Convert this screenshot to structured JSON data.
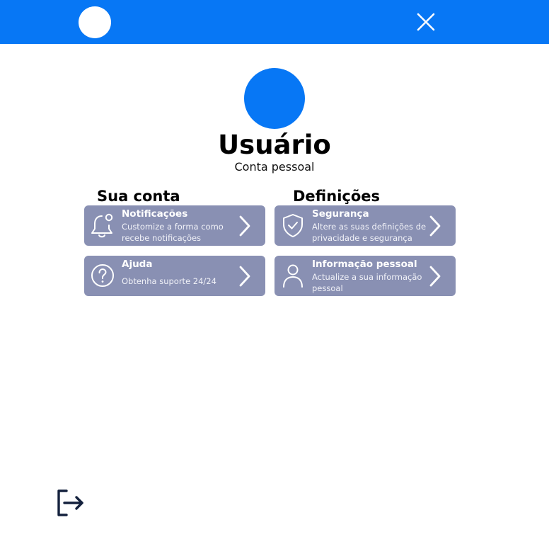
{
  "header": {
    "background_color": "#0777f5",
    "avatar_icon": "user-avatar",
    "close_icon": "close-icon"
  },
  "profile": {
    "name": "Usuário",
    "subtitle": "Conta pessoal",
    "avatar_color": "#0777f5"
  },
  "sections": {
    "account": {
      "title": "Sua conta",
      "items": [
        {
          "title": "Notificações",
          "description": "Customize a forma como recebe notificações",
          "icon": "bell-icon"
        },
        {
          "title": "Ajuda",
          "description": "Obtenha suporte 24/24",
          "icon": "help-circle-icon"
        }
      ]
    },
    "settings": {
      "title": "Definições",
      "items": [
        {
          "title": "Segurança",
          "description": "Altere as suas definições de privacidade e segurança",
          "icon": "shield-check-icon"
        },
        {
          "title": "Informação pessoal",
          "description": "Actualize a sua informação pessoal",
          "icon": "user-icon"
        }
      ]
    }
  },
  "card_color": "#8990b3",
  "logout": {
    "icon": "logout-icon",
    "color": "#14213d"
  }
}
